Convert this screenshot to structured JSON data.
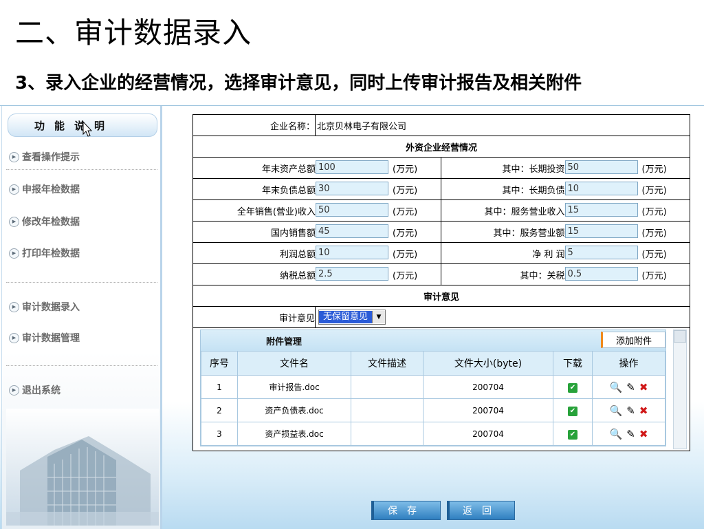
{
  "slide": {
    "title": "二、审计数据录入",
    "subtitle": "3、录入企业的经营情况，选择审计意见，同时上传审计报告及相关附件"
  },
  "sidebar": {
    "header": "功能说明",
    "items": [
      {
        "label": "查看操作提示"
      },
      {
        "label": "申报年检数据"
      },
      {
        "label": "修改年检数据"
      },
      {
        "label": "打印年检数据"
      },
      {
        "label": "审计数据录入"
      },
      {
        "label": "审计数据管理"
      },
      {
        "label": "退出系统"
      }
    ]
  },
  "form": {
    "company_label": "企业名称：",
    "company_name": "北京贝林电子有限公司",
    "section_ops": "外资企业经营情况",
    "unit": "(万元)",
    "rows": [
      {
        "l_label": "年末资产总额",
        "l_value": "100",
        "r_label": "其中：长期投资",
        "r_value": "50"
      },
      {
        "l_label": "年末负债总额",
        "l_value": "30",
        "r_label": "其中：长期负债",
        "r_value": "10"
      },
      {
        "l_label": "全年销售(营业)收入",
        "l_value": "50",
        "r_label": "其中：服务营业收入",
        "r_value": "15"
      },
      {
        "l_label": "国内销售额",
        "l_value": "45",
        "r_label": "其中：服务营业额",
        "r_value": "15"
      },
      {
        "l_label": "利润总额",
        "l_value": "10",
        "r_label": "净 利 润",
        "r_value": "5"
      },
      {
        "l_label": "纳税总额",
        "l_value": "2.5",
        "r_label": "其中：关税",
        "r_value": "0.5"
      }
    ],
    "section_opinion": "审计意见",
    "opinion_label": "审计意见",
    "opinion_value": "无保留意见"
  },
  "attachments": {
    "title": "附件管理",
    "add_button": "添加附件",
    "columns": [
      "序号",
      "文件名",
      "文件描述",
      "文件大小(byte)",
      "下载",
      "操作"
    ],
    "rows": [
      {
        "no": "1",
        "name": "审计报告.doc",
        "desc": "",
        "size": "200704"
      },
      {
        "no": "2",
        "name": "资产负债表.doc",
        "desc": "",
        "size": "200704"
      },
      {
        "no": "3",
        "name": "资产损益表.doc",
        "desc": "",
        "size": "200704"
      }
    ]
  },
  "buttons": {
    "save": "保存",
    "back": "返回"
  },
  "colors": {
    "input_bg": "#dff1fb",
    "accent_blue": "#2f7fc0",
    "add_button_accent": "#f18a1b",
    "download_green": "#27a23a"
  }
}
